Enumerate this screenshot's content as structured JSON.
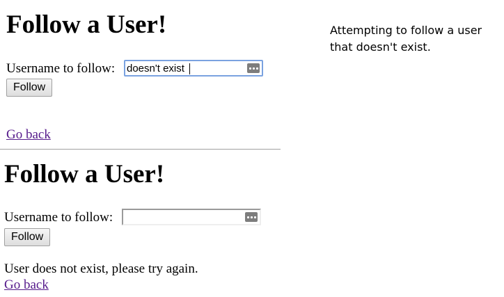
{
  "top_panel": {
    "title": "Follow a User!",
    "username_label": "Username to follow:",
    "username_value": "doesn't exist",
    "follow_button": "Follow",
    "go_back_link": "Go back"
  },
  "bottom_panel": {
    "title": "Follow a User!",
    "username_label": "Username to follow:",
    "username_value": "",
    "follow_button": "Follow",
    "error_message": "User does not exist, please try again.",
    "go_back_link": "Go back"
  },
  "caption": "Attempting to follow a user that doesn't exist.",
  "colors": {
    "link_visited": "#551a8b",
    "focus_border": "#7aa2e0",
    "divider": "#a0a0a0"
  },
  "icons": {
    "password_manager": "keys-icon"
  }
}
